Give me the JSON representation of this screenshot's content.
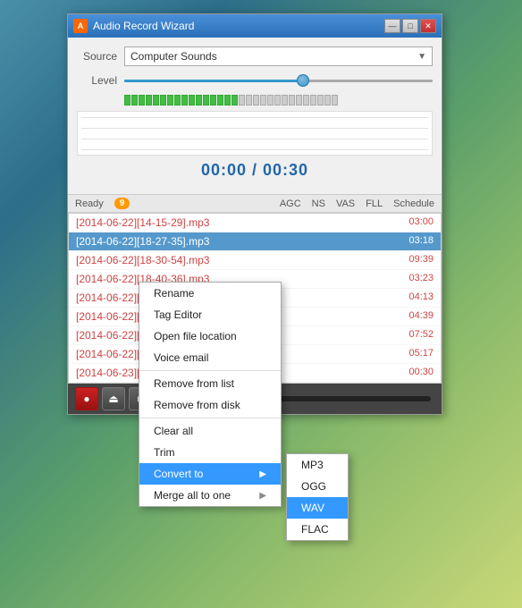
{
  "window": {
    "title": "Audio Record Wizard",
    "icon_label": "A"
  },
  "title_buttons": {
    "minimize": "—",
    "maximize": "□",
    "close": "✕"
  },
  "source": {
    "label": "Source",
    "value": "Computer Sounds"
  },
  "level": {
    "label": "Level",
    "active_segments": 16,
    "total_segments": 30
  },
  "timer": {
    "display": "00:00 / 00:30"
  },
  "toolbar": {
    "ready_label": "Ready",
    "ready_count": "9",
    "agc_label": "AGC",
    "ns_label": "NS",
    "vas_label": "VAS",
    "fll_label": "FLL",
    "schedule_label": "Schedule"
  },
  "file_list": [
    {
      "name": "[2014-06-22][14-15-29].mp3",
      "duration": "03:00",
      "selected": false
    },
    {
      "name": "[2014-06-22][18-27-35].mp3",
      "duration": "03:18",
      "selected": false,
      "highlighted": true
    },
    {
      "name": "[2014-06-22][18-30-54].mp3",
      "duration": "09:39",
      "selected": false
    },
    {
      "name": "[2014-06-22][18-40-36].mp3",
      "duration": "03:23",
      "selected": false
    },
    {
      "name": "[2014-06-22][18-44-01].mp3",
      "duration": "04:13",
      "selected": false
    },
    {
      "name": "[2014-06-22][18-48-19].mp3",
      "duration": "04:39",
      "selected": false
    },
    {
      "name": "[2014-06-22][18-53-05].mp3",
      "duration": "07:52",
      "selected": false
    },
    {
      "name": "[2014-06-22][19-00-58].mp3",
      "duration": "05:17",
      "selected": false
    },
    {
      "name": "[2014-06-23][18-04-46].mp3",
      "duration": "00:30",
      "selected": false,
      "current": true
    }
  ],
  "context_menu": {
    "items": [
      {
        "label": "Rename",
        "has_submenu": false
      },
      {
        "label": "Tag Editor",
        "has_submenu": false
      },
      {
        "label": "Open file location",
        "has_submenu": false
      },
      {
        "label": "Voice email",
        "has_submenu": false
      },
      {
        "label": "Remove from list",
        "has_submenu": false
      },
      {
        "label": "Remove from disk",
        "has_submenu": false
      },
      {
        "label": "Clear all",
        "has_submenu": false
      },
      {
        "label": "Trim",
        "has_submenu": false
      },
      {
        "label": "Convert to",
        "has_submenu": true,
        "active": true
      },
      {
        "label": "Merge all to one",
        "has_submenu": true
      }
    ]
  },
  "submenu": {
    "items": [
      {
        "label": "MP3",
        "selected": false
      },
      {
        "label": "OGG",
        "selected": false
      },
      {
        "label": "WAV",
        "selected": true
      },
      {
        "label": "FLAC",
        "selected": false
      }
    ]
  },
  "playback": {
    "record_btn": "●",
    "eject_btn": "⏏",
    "stop_btn": "■"
  }
}
